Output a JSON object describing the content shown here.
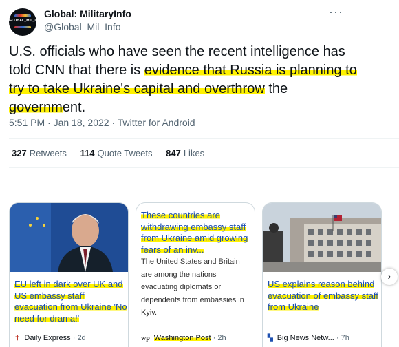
{
  "account": {
    "display_name": "Global: MilitaryInfo",
    "handle": "@Global_Mil_Info",
    "avatar_text": "GLOBAL_MIL_INFO"
  },
  "tweet": {
    "text_plain_start": "U.S. officials who have seen the recent intelligence has told CNN that there is ",
    "text_highlight_1": "evidence that Russia is planning to try to take Ukraine's capital and overthrow",
    "text_mid": " the ",
    "text_highlight_2": "governm",
    "text_end": "ent.",
    "time": "5:51 PM",
    "date": "Jan 18, 2022",
    "source": "Twitter for Android"
  },
  "stats": {
    "retweets_count": "327",
    "retweets_label": "Retweets",
    "quotes_count": "114",
    "quotes_label": "Quote Tweets",
    "likes_count": "847",
    "likes_label": "Likes"
  },
  "cards": [
    {
      "title": "EU left in dark over UK and US embassy staff evacuation from Ukraine 'No need for drama!'",
      "source": "Daily Express",
      "time": "2d",
      "icon": "express-icon"
    },
    {
      "title": "These countries are withdrawing embassy staff from Ukraine amid growing fears of an inv...",
      "description": "The United States and Britain are among the nations evacuating diplomats or dependents from embassies in Kyiv.",
      "source": "Washington Post",
      "time": "2h",
      "icon": "wp-icon"
    },
    {
      "title": "US explains reason behind evacuation of embassy staff from Ukraine",
      "source": "Big News Netw...",
      "time": "7h",
      "icon": "bignews-icon"
    }
  ],
  "colors": {
    "highlight": "#fff200",
    "link": "#1d4fb0",
    "muted": "#536471"
  },
  "sep": "·"
}
